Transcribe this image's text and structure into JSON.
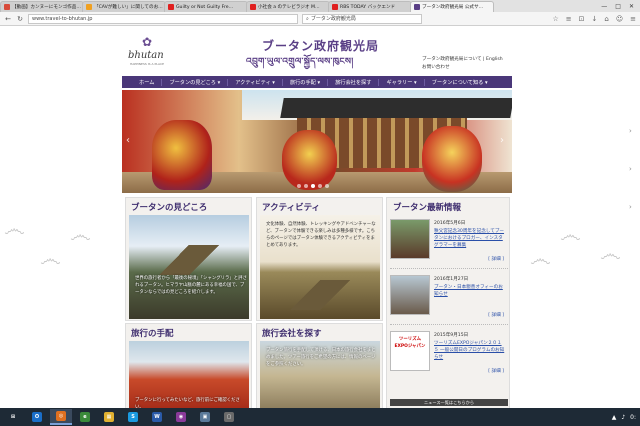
{
  "browser": {
    "tabs": [
      {
        "label": "【動画】カンヌーにモンゴ作品…",
        "color": "#d84a3a"
      },
      {
        "label": "「CAVが難しい」に関してのお…",
        "color": "#f0a020"
      },
      {
        "label": "Guilty or Not Guilty Fre…",
        "color": "#e02020"
      },
      {
        "label": "小社会 a のテレビラジオ M…",
        "color": "#e02020"
      },
      {
        "label": "RBS TODAY バックエンド",
        "color": "#e02020"
      },
      {
        "label": "ブータン政府観光局 公式サ…",
        "color": "#5a3f86",
        "active": true
      }
    ],
    "window_buttons": [
      "—",
      "□",
      "✕"
    ],
    "url": "www.travel-to-bhutan.jp",
    "search_text": "ブータン政府観光局"
  },
  "header": {
    "logo_script": "bhutan",
    "logo_sub": "HAPPINESS IS A PLACE",
    "title": "ブータン政府観光局",
    "title_dz": "འབྲུག་ཡུལ་འགྲུལ་སྐྱོད་ལས་ཁུངས།",
    "links": [
      "ブータン政府観光局について | English",
      "お問い合わせ"
    ]
  },
  "nav": [
    "ホーム",
    "ブータンの見どころ ▾",
    "アクティビティ ▾",
    "旅行の手配 ▾",
    "旅行会社を探す",
    "ギャラリー ▾",
    "ブータンについて知る ▾"
  ],
  "hero": {
    "prev": "‹",
    "next": "›"
  },
  "panels": [
    {
      "title": "ブータンの見どころ",
      "desc": "世界の旅行者から「最後の秘境」「シャングリラ」と評されるブータン。ヒマラヤ山脈の麓にある幸福の国で、ブータンならではの見どころを紹介します。"
    },
    {
      "title": "アクティビティ",
      "desc": "文化体験、自然体験、トレッキングやアドベンチャーなど、ブータンで体験できる楽しみは多種多様です。こちらのページではブータン体験できるアクティビティをまとめてあります。"
    },
    {
      "title": "旅行の手配",
      "desc": "ブータンに行ってみたいなど、旅行前にご確認ください。"
    },
    {
      "title": "旅行会社を探す",
      "desc": "ブータン旅行を手配して頂ける、日本の旅行会社をまとめました。ツアー旅行をご希望の方には、情報のページをご参照ください。"
    }
  ],
  "news": {
    "title": "ブータン最新情報",
    "items": [
      {
        "date": "2016年5月6日",
        "text": "秩父宮記念30周年を記念してブータンにおけるブロガー、インスタグラマーを募集",
        "more": "[ 詳細 ]"
      },
      {
        "date": "2016年1月27日",
        "text": "ブータン・日本親善オフィーのお知らせ",
        "more": "[ 詳細 ]"
      },
      {
        "date": "2015年9月15日",
        "text": "ツーリズムEXPOジャパン２０１５ 一般公開日のプログラムのお知らせ",
        "more": "[ 詳細 ]"
      }
    ],
    "thumb_label": "ツーリズムEXPOジャパン",
    "sns_label": "ニュース一覧はこちらから",
    "sns": [
      {
        "name": "facebook",
        "glyph": "f",
        "color": "#8b6a2a"
      },
      {
        "name": "twitter",
        "glyph": "t",
        "color": "#8b6a2a"
      },
      {
        "name": "youtube",
        "glyph": "You",
        "color": "#8b6a2a"
      },
      {
        "name": "flickr",
        "glyph": "••",
        "color": "#8b6a2a"
      }
    ]
  },
  "taskbar": {
    "items": [
      "⊞",
      "O",
      "◎",
      "e",
      "▦",
      "S",
      "W",
      "◉",
      "▣",
      "▢"
    ],
    "clock": "0:"
  }
}
